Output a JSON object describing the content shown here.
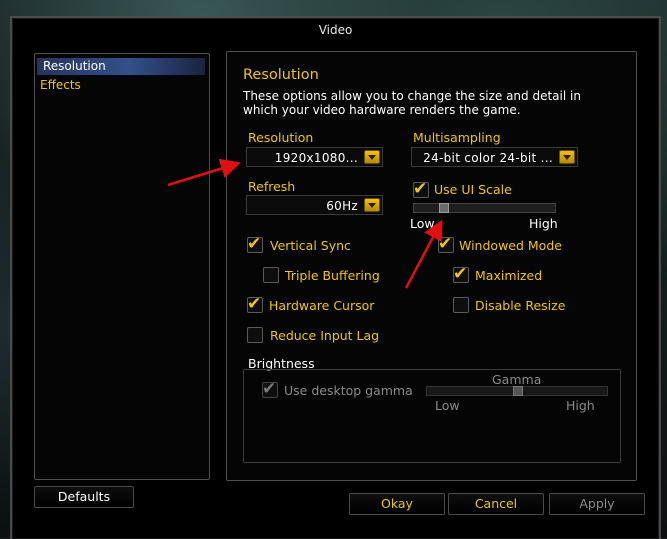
{
  "window": {
    "title": "Video"
  },
  "sidebar": {
    "items": [
      {
        "label": "Resolution",
        "selected": true
      },
      {
        "label": "Effects",
        "selected": false
      }
    ]
  },
  "main": {
    "heading": "Resolution",
    "description_line1": "These options allow you to change the size and detail in",
    "description_line2": "which your video hardware renders the game.",
    "resolution": {
      "label": "Resolution",
      "value": "1920x1080..."
    },
    "refresh": {
      "label": "Refresh",
      "value": "60Hz"
    },
    "multisampling": {
      "label": "Multisampling",
      "value": "24-bit color 24-bit ..."
    },
    "ui_scale": {
      "label": "Use UI Scale",
      "checked": true,
      "low": "Low",
      "high": "High",
      "level": 0.2
    },
    "checkboxes": {
      "vertical_sync": {
        "label": "Vertical Sync",
        "checked": true
      },
      "triple_buffering": {
        "label": "Triple Buffering",
        "checked": false
      },
      "hardware_cursor": {
        "label": "Hardware Cursor",
        "checked": true
      },
      "reduce_input_lag": {
        "label": "Reduce Input Lag",
        "checked": false
      },
      "windowed_mode": {
        "label": "Windowed Mode",
        "checked": true
      },
      "maximized": {
        "label": "Maximized",
        "checked": true
      },
      "disable_resize": {
        "label": "Disable Resize",
        "checked": false
      }
    },
    "brightness": {
      "label": "Brightness",
      "use_desktop_gamma": {
        "label": "Use desktop gamma",
        "checked": true,
        "disabled": true
      },
      "gamma": {
        "label": "Gamma",
        "low": "Low",
        "high": "High",
        "level": 0.5
      }
    }
  },
  "buttons": {
    "defaults": "Defaults",
    "okay": "Okay",
    "cancel": "Cancel",
    "apply": "Apply"
  },
  "colors": {
    "accent_gold": "#f0c419",
    "annotation_arrow": "#e01010",
    "selection_blue": "#33508a"
  }
}
